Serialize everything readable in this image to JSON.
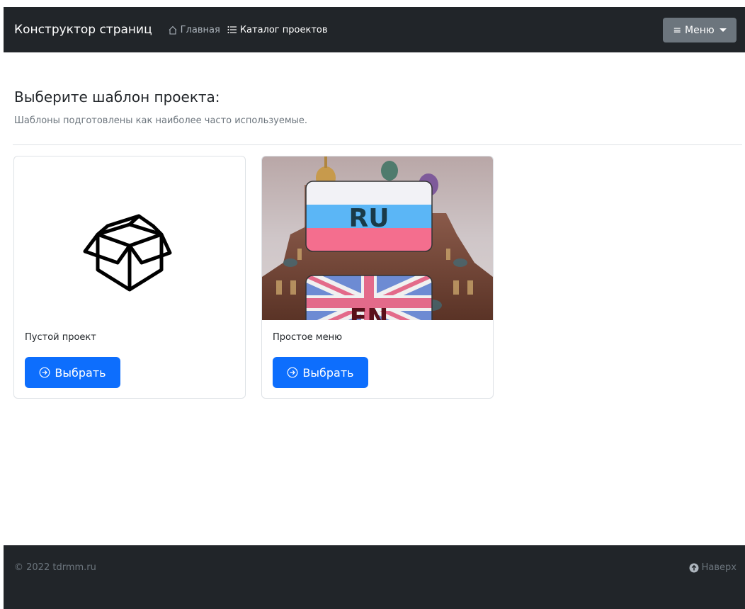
{
  "navbar": {
    "brand": "Конструктор страниц",
    "links": [
      {
        "label": "Главная",
        "icon": "house-icon"
      },
      {
        "label": "Каталог проектов",
        "icon": "list-icon"
      }
    ],
    "menu_button": {
      "label": "Меню",
      "icon": "hamburger-icon"
    }
  },
  "header": {
    "title": "Выберите шаблон проекта:",
    "subtitle": "Шаблоны подготовлены как наиболее часто используемые."
  },
  "cards": [
    {
      "title": "Пустой проект",
      "button": "Выбрать",
      "image": "box-icon"
    },
    {
      "title": "Простое меню",
      "button": "Выбрать",
      "image": "church-with-flags",
      "image_text": {
        "top_flag": "RU",
        "bottom_flag": "EN"
      }
    }
  ],
  "footer": {
    "copyright": "© 2022 tdrmm.ru",
    "to_top": "Наверх"
  },
  "colors": {
    "navbar_bg": "#212529",
    "primary": "#0d6efd",
    "secondary": "#6c757d"
  }
}
